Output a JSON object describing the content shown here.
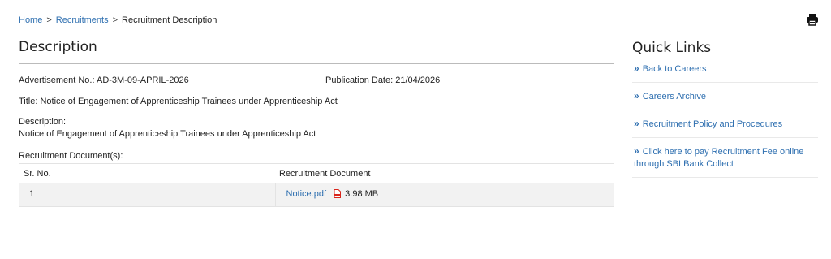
{
  "breadcrumb": {
    "home": "Home",
    "sep1": ">",
    "recruitments": "Recruitments",
    "sep2": ">",
    "current": "Recruitment Description"
  },
  "print_icon": "printer-icon",
  "main": {
    "title": "Description",
    "advertisement": "Advertisement No.: AD-3M-09-APRIL-2026",
    "publication": "Publication Date: 21/04/2026",
    "title_line": "Title: Notice of Engagement of Apprenticeship Trainees under Apprenticeship Act",
    "description_label": "Description:",
    "description_text": "Notice of Engagement of Apprenticeship Trainees under Apprenticeship Act",
    "documents_label": "Recruitment Document(s):",
    "table": {
      "headers": [
        "Sr. No.",
        "Recruitment Document"
      ],
      "rows": [
        {
          "sr": "1",
          "file": "Notice.pdf",
          "size": "3.98 MB"
        }
      ]
    }
  },
  "quick_links": {
    "title": "Quick Links",
    "chevron": "»",
    "items": [
      "Back to Careers",
      "Careers Archive",
      "Recruitment Policy and Procedures",
      "Click here to pay Recruitment Fee online through SBI Bank Collect"
    ]
  },
  "colors": {
    "link": "#2e6fb0",
    "pdf": "#d9251c"
  }
}
